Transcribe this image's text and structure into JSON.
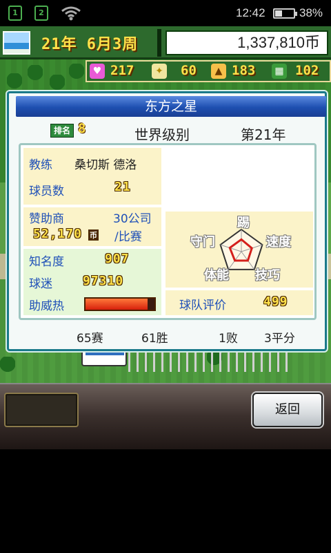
{
  "status_bar": {
    "time": "12:42",
    "battery": "38%",
    "notif1": "1",
    "notif2": "2",
    "battery_level_pct": 38
  },
  "top_bar": {
    "date": "21年 6月3周",
    "money": "1,337,810币"
  },
  "resources": {
    "hearts": "217",
    "ideas": "60",
    "food": "183",
    "fields": "102"
  },
  "team": {
    "name": "东方之星",
    "rank_label": "排名",
    "rank_value": "8",
    "level": "世界级别",
    "year": "第21年",
    "coach_label": "教练",
    "coach_name": "桑切斯  德洛",
    "players_label": "球员数",
    "players_value": "21",
    "sponsor_label": "赞助商",
    "sponsor_count": "30公司",
    "sponsor_amount": "52,170",
    "sponsor_currency": "币",
    "sponsor_unit": "/比赛",
    "fame_label": "知名度",
    "fame_value": "907",
    "fans_label": "球迷",
    "fans_value": "97310",
    "cheer_label": "助威热",
    "cheer_level_pct": 90,
    "radar": {
      "kick": "踢",
      "speed": "速度",
      "technique": "技巧",
      "stamina": "体能",
      "defense": "守门",
      "values": [
        0.55,
        0.5,
        0.5,
        0.5,
        0.55
      ]
    },
    "eval_label": "球队评价",
    "eval_value": "499"
  },
  "record": {
    "games": "65赛",
    "wins": "61胜",
    "losses": "1败",
    "draws": "3平分"
  },
  "buttons": {
    "back": "返回"
  },
  "colors": {
    "panel_border": "#1a7a8a",
    "title_blue": "#1e4fb0",
    "label_blue": "#1f50b8",
    "pixel_yellow": "#ffe14a"
  }
}
